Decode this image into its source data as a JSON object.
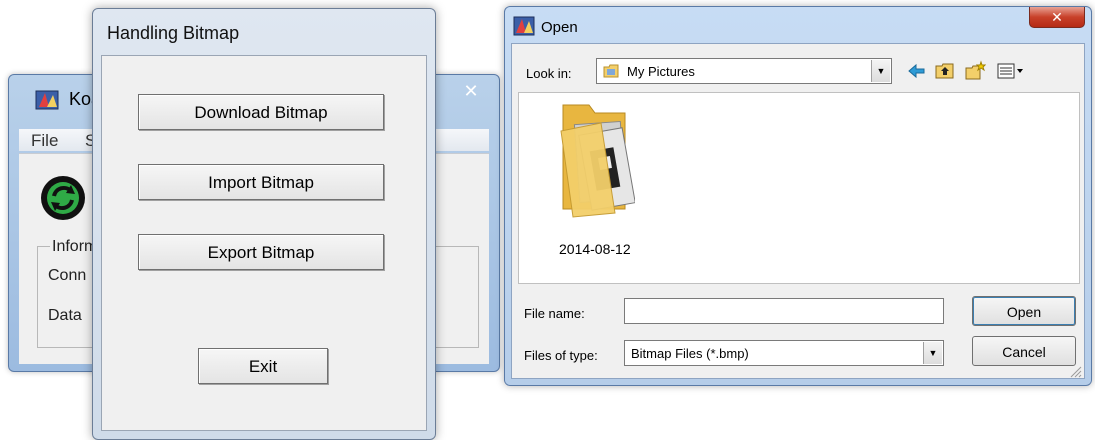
{
  "background_window": {
    "title": "Koa",
    "close_glyph": "✕",
    "menu": {
      "file": "File",
      "second_partial": "S"
    },
    "group": {
      "label": "Inform",
      "row1": "Conn",
      "row2": "Data"
    },
    "icons": {
      "app": "app-icon",
      "sync": "sync-icon"
    }
  },
  "handling_bitmap": {
    "title": "Handling Bitmap",
    "buttons": {
      "download": "Download Bitmap",
      "import": "Import Bitmap",
      "export": "Export Bitmap",
      "exit": "Exit"
    }
  },
  "open_dialog": {
    "title": "Open",
    "close_glyph": "✕",
    "look_in": {
      "label": "Look in:",
      "value": "My Pictures"
    },
    "toolbar_icons": [
      "back-arrow-icon",
      "up-folder-icon",
      "new-folder-icon",
      "views-menu-icon"
    ],
    "files": [
      {
        "name": "2014-08-12",
        "icon": "folder-icon"
      }
    ],
    "file_name": {
      "label": "File name:",
      "value": "",
      "placeholder": ""
    },
    "file_type": {
      "label": "Files of type:",
      "value": "Bitmap Files (*.bmp)"
    },
    "buttons": {
      "open": "Open",
      "cancel": "Cancel"
    }
  },
  "colors": {
    "titlebar_blue": "#b9d1ea",
    "dialog_face": "#f0f0f0",
    "close_red": "#c8412a",
    "folder_yellow": "#f3cf6a"
  }
}
